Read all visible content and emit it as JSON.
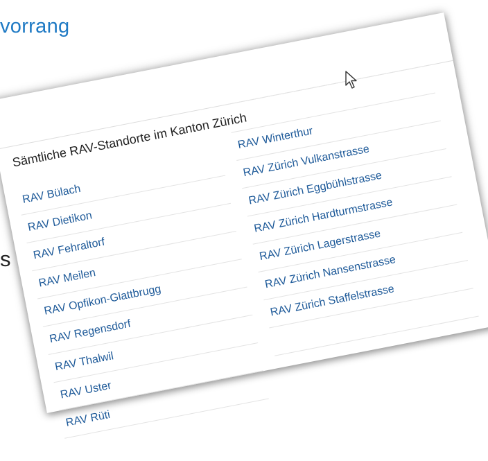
{
  "slide": {
    "heading_fragment": "vorrang",
    "side_fragment": "s"
  },
  "rav_panel": {
    "title": "Sämtliche RAV-Standorte im Kanton Zürich",
    "left_column": [
      "RAV Bülach",
      "RAV Dietikon",
      "RAV Fehraltorf",
      "RAV Meilen",
      "RAV Opfikon-Glattbrugg",
      "RAV Regensdorf",
      "RAV Thalwil",
      "RAV Uster",
      "RAV Rüti"
    ],
    "right_column": [
      "RAV Winterthur",
      "RAV Zürich Vulkanstrasse",
      "RAV Zürich Eggbühlstrasse",
      "RAV Zürich Hardturmstrasse",
      "RAV Zürich Lagerstrasse",
      "RAV Zürich Nansenstrasse",
      "RAV Zürich Staffelstrasse"
    ]
  },
  "colors": {
    "heading": "#1f7ac4",
    "link": "#1e5a99",
    "rule": "#e3e3e3"
  },
  "icons": {
    "cursor": "mouse-pointer-icon"
  }
}
